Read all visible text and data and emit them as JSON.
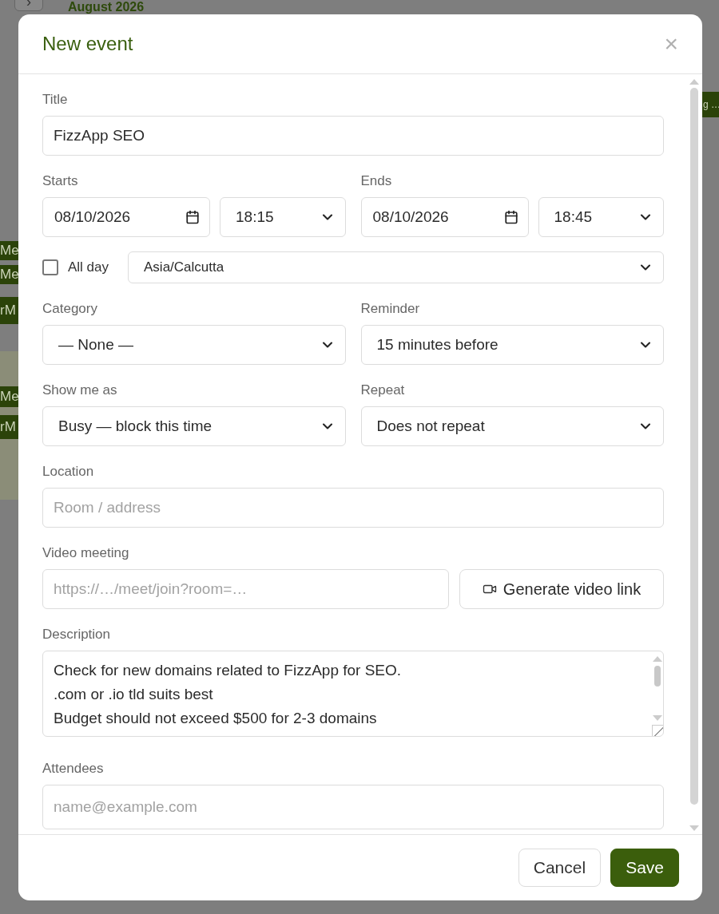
{
  "background": {
    "nav_button": "›",
    "month_title": "August 2026",
    "left_chips": [
      "Me",
      "Me",
      "rM",
      "Me",
      "rM"
    ],
    "right_chips": [
      "g …"
    ]
  },
  "dialog": {
    "title": "New event",
    "close": "×"
  },
  "fields": {
    "title": {
      "label": "Title",
      "value": "FizzApp SEO"
    },
    "starts": {
      "label": "Starts",
      "date": "08/10/2026",
      "time": "18:15"
    },
    "ends": {
      "label": "Ends",
      "date": "08/10/2026",
      "time": "18:45"
    },
    "all_day": {
      "label": "All day",
      "checked": false
    },
    "timezone": {
      "value": "Asia/Calcutta"
    },
    "category": {
      "label": "Category",
      "value": "— None —"
    },
    "reminder": {
      "label": "Reminder",
      "value": "15 minutes before"
    },
    "show_me_as": {
      "label": "Show me as",
      "value": "Busy — block this time"
    },
    "repeat": {
      "label": "Repeat",
      "value": "Does not repeat"
    },
    "location": {
      "label": "Location",
      "placeholder": "Room / address"
    },
    "video_meeting": {
      "label": "Video meeting",
      "placeholder": "https://…/meet/join?room=…",
      "button": "Generate video link"
    },
    "description": {
      "label": "Description",
      "value": "Check for new domains related to FizzApp for SEO.\n.com or .io tld suits best\nBudget should not exceed $500 for 2-3 domains"
    },
    "attendees": {
      "label": "Attendees",
      "placeholder": "name@example.com"
    }
  },
  "footer": {
    "buttons": [
      {
        "label": "Cancel",
        "kind": "secondary"
      },
      {
        "label": "Save",
        "kind": "primary"
      }
    ]
  }
}
